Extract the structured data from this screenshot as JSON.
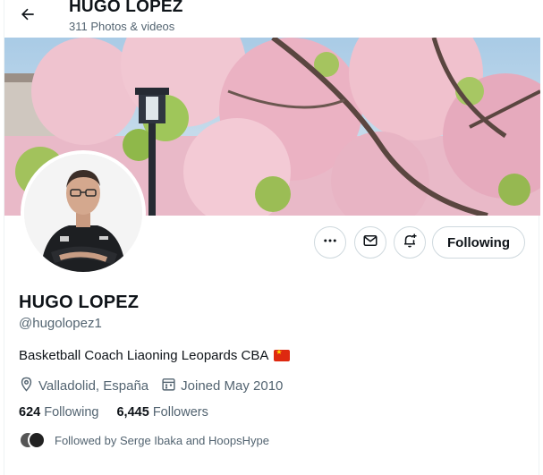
{
  "header": {
    "title": "HUGO LOPEZ",
    "subtitle": "311 Photos & videos",
    "back_icon": "arrow-left-icon"
  },
  "actions": {
    "more_icon": "more-horizontal-icon",
    "message_icon": "envelope-icon",
    "notifications_icon": "bell-plus-icon",
    "following_label": "Following"
  },
  "profile": {
    "name": "HUGO LOPEZ",
    "handle": "@hugolopez1",
    "bio": "Basketball Coach  Liaoning Leopards CBA",
    "bio_flag_icon": "china-flag-icon",
    "location": "Valladolid, España",
    "joined": "Joined May 2010",
    "following_count": "624",
    "following_label": "Following",
    "followers_count": "6,445",
    "followers_label": "Followers",
    "followed_by": "Followed by Serge Ibaka and HoopsHype"
  },
  "colors": {
    "text_primary": "#0f1419",
    "text_secondary": "#536471",
    "border": "#cfd9de"
  }
}
